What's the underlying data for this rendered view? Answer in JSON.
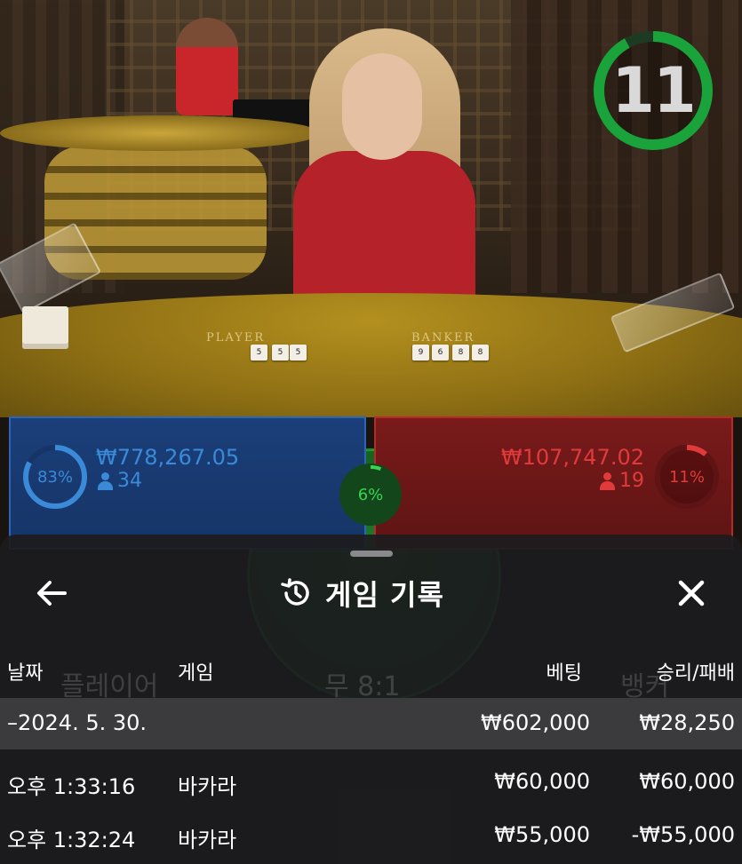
{
  "stream": {
    "table_labels": {
      "player": "PLAYER",
      "banker": "BANKER"
    },
    "player_cards": [
      "5",
      "5"
    ],
    "banker_cards": [
      "9",
      "8",
      "6",
      "8"
    ],
    "countdown": "11",
    "countdown_fraction": 0.92
  },
  "bets": {
    "player": {
      "percent_label": "83%",
      "percent": 83,
      "amount": "₩778,267.05",
      "players": "34",
      "color": "#3a8ad8"
    },
    "tie": {
      "percent_label": "6%",
      "percent": 6,
      "color": "#39d44f"
    },
    "banker": {
      "percent_label": "11%",
      "percent": 11,
      "amount": "₩107,747.02",
      "players": "19",
      "color": "#e03a3a"
    }
  },
  "history": {
    "title": "게임 기록",
    "columns": {
      "date": "날짜",
      "game": "게임",
      "bet": "베팅",
      "result": "승리/패배"
    },
    "date_row": {
      "date": "–2024. 5. 30.",
      "bet": "₩602,000",
      "result": "₩28,250"
    },
    "rows": [
      {
        "time": "오후 1:33:16",
        "game": "바카라",
        "bet": "₩60,000",
        "result": "₩60,000"
      },
      {
        "time": "오후 1:32:24",
        "game": "바카라",
        "bet": "₩55,000",
        "result": "-₩55,000"
      }
    ]
  }
}
